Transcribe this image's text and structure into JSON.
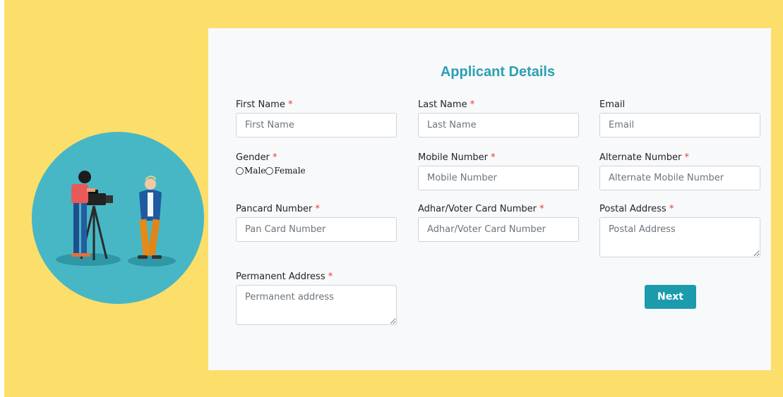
{
  "form": {
    "title": "Applicant Details",
    "required_mark": "*",
    "fields": {
      "first_name": {
        "label": "First Name",
        "placeholder": "First Name"
      },
      "last_name": {
        "label": "Last Name",
        "placeholder": "Last Name"
      },
      "email": {
        "label": "Email",
        "placeholder": "Email"
      },
      "gender": {
        "label": "Gender",
        "options": [
          "Male",
          "Female"
        ]
      },
      "mobile_number": {
        "label": "Mobile Number",
        "placeholder": "Mobile Number"
      },
      "alternate_number": {
        "label": "Alternate Number",
        "placeholder": "Alternate Mobile Number"
      },
      "pancard_number": {
        "label": "Pancard Number",
        "placeholder": "Pan Card Number"
      },
      "adhar_number": {
        "label": "Adhar/Voter Card Number",
        "placeholder": "Adhar/Voter Card Number"
      },
      "postal_address": {
        "label": "Postal Address",
        "placeholder": "Postal Address"
      },
      "permanent_address": {
        "label": "Permanent Address",
        "placeholder": "Permanent address"
      }
    },
    "next_label": "Next"
  },
  "colors": {
    "page_background": "#fcde6a",
    "card_background": "#f8f9fb",
    "accent": "#1c9bad",
    "title": "#2aa0b3",
    "required": "#e53935"
  },
  "illustration": {
    "icon": "videographer-illustration"
  }
}
